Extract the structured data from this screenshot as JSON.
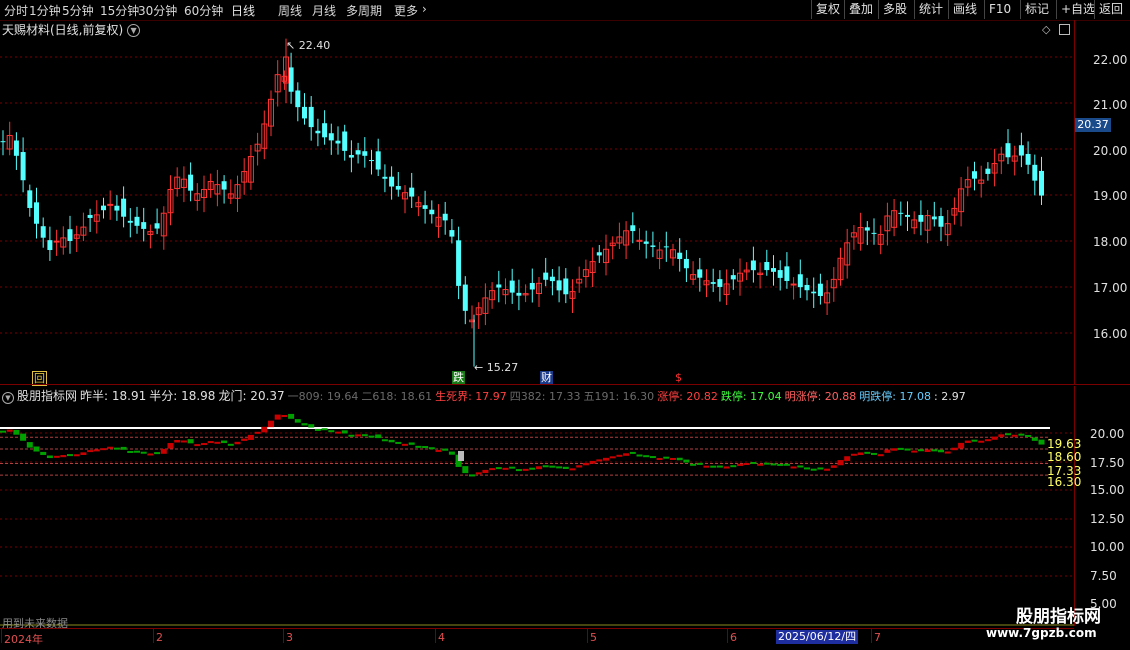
{
  "toolbar": {
    "periods": [
      "分时",
      "1分钟",
      "5分钟",
      "15分钟",
      "30分钟",
      "60分钟",
      "日线",
      "周线",
      "月线",
      "多周期",
      "更多"
    ],
    "active_period": "日线",
    "right_buttons": [
      "复权",
      "叠加",
      "多股",
      "统计",
      "画线",
      "F10",
      "标记",
      "+自选",
      "返回"
    ]
  },
  "main_chart": {
    "title": "天赐材料(日线,前复权)",
    "price_labels": [
      "22.00",
      "21.00",
      "20.00",
      "19.00",
      "18.00",
      "17.00",
      "16.00"
    ],
    "current_price": "20.37",
    "high_label": "22.40",
    "low_label": "15.27",
    "signal_marks": [
      "回",
      "跌",
      "财",
      "$"
    ]
  },
  "indicator": {
    "name": "股朋指标网",
    "items": [
      {
        "text": "昨半: 18.91",
        "color": "#e0e0e0"
      },
      {
        "text": "半分: 18.98",
        "color": "#e0e0e0"
      },
      {
        "text": "龙门: 20.37",
        "color": "#e0e0e0"
      },
      {
        "text": "一809: 19.64",
        "color": "#6a6a6a"
      },
      {
        "text": "二618: 18.61",
        "color": "#6a6a6a"
      },
      {
        "text": "生死界: 17.97",
        "color": "#ff4040"
      },
      {
        "text": "四382: 17.33",
        "color": "#6a6a6a"
      },
      {
        "text": "五191: 16.30",
        "color": "#6a6a6a"
      },
      {
        "text": "涨停: 20.82",
        "color": "#ff4040"
      },
      {
        "text": "跌停: 17.04",
        "color": "#40ff40"
      },
      {
        "text": "明涨停: 20.88",
        "color": "#ff6060"
      },
      {
        "text": "明跌停: 17.08",
        "color": "#66ccff"
      },
      {
        "text": ": 2.97",
        "color": "#e0e0e0"
      }
    ],
    "axis_labels": [
      "20.00",
      "17.50",
      "15.00",
      "12.50",
      "10.00",
      "7.50",
      "5.00"
    ],
    "level_labels": [
      "19.63",
      "18.60",
      "17.33",
      "16.30"
    ],
    "footer_note": "用到未来数据"
  },
  "date_axis": {
    "labels": [
      "2024年",
      "2",
      "3",
      "4",
      "5",
      "6",
      "7"
    ],
    "cursor_date": "2025/06/12/四"
  },
  "watermark": {
    "title": "股朋指标网",
    "url": "www.7gpzb.com"
  },
  "colors": {
    "up": "#ff3232",
    "down": "#54ffff",
    "sub_up": "#c80000",
    "sub_down": "#00a000",
    "grid": "#7a0000"
  }
}
